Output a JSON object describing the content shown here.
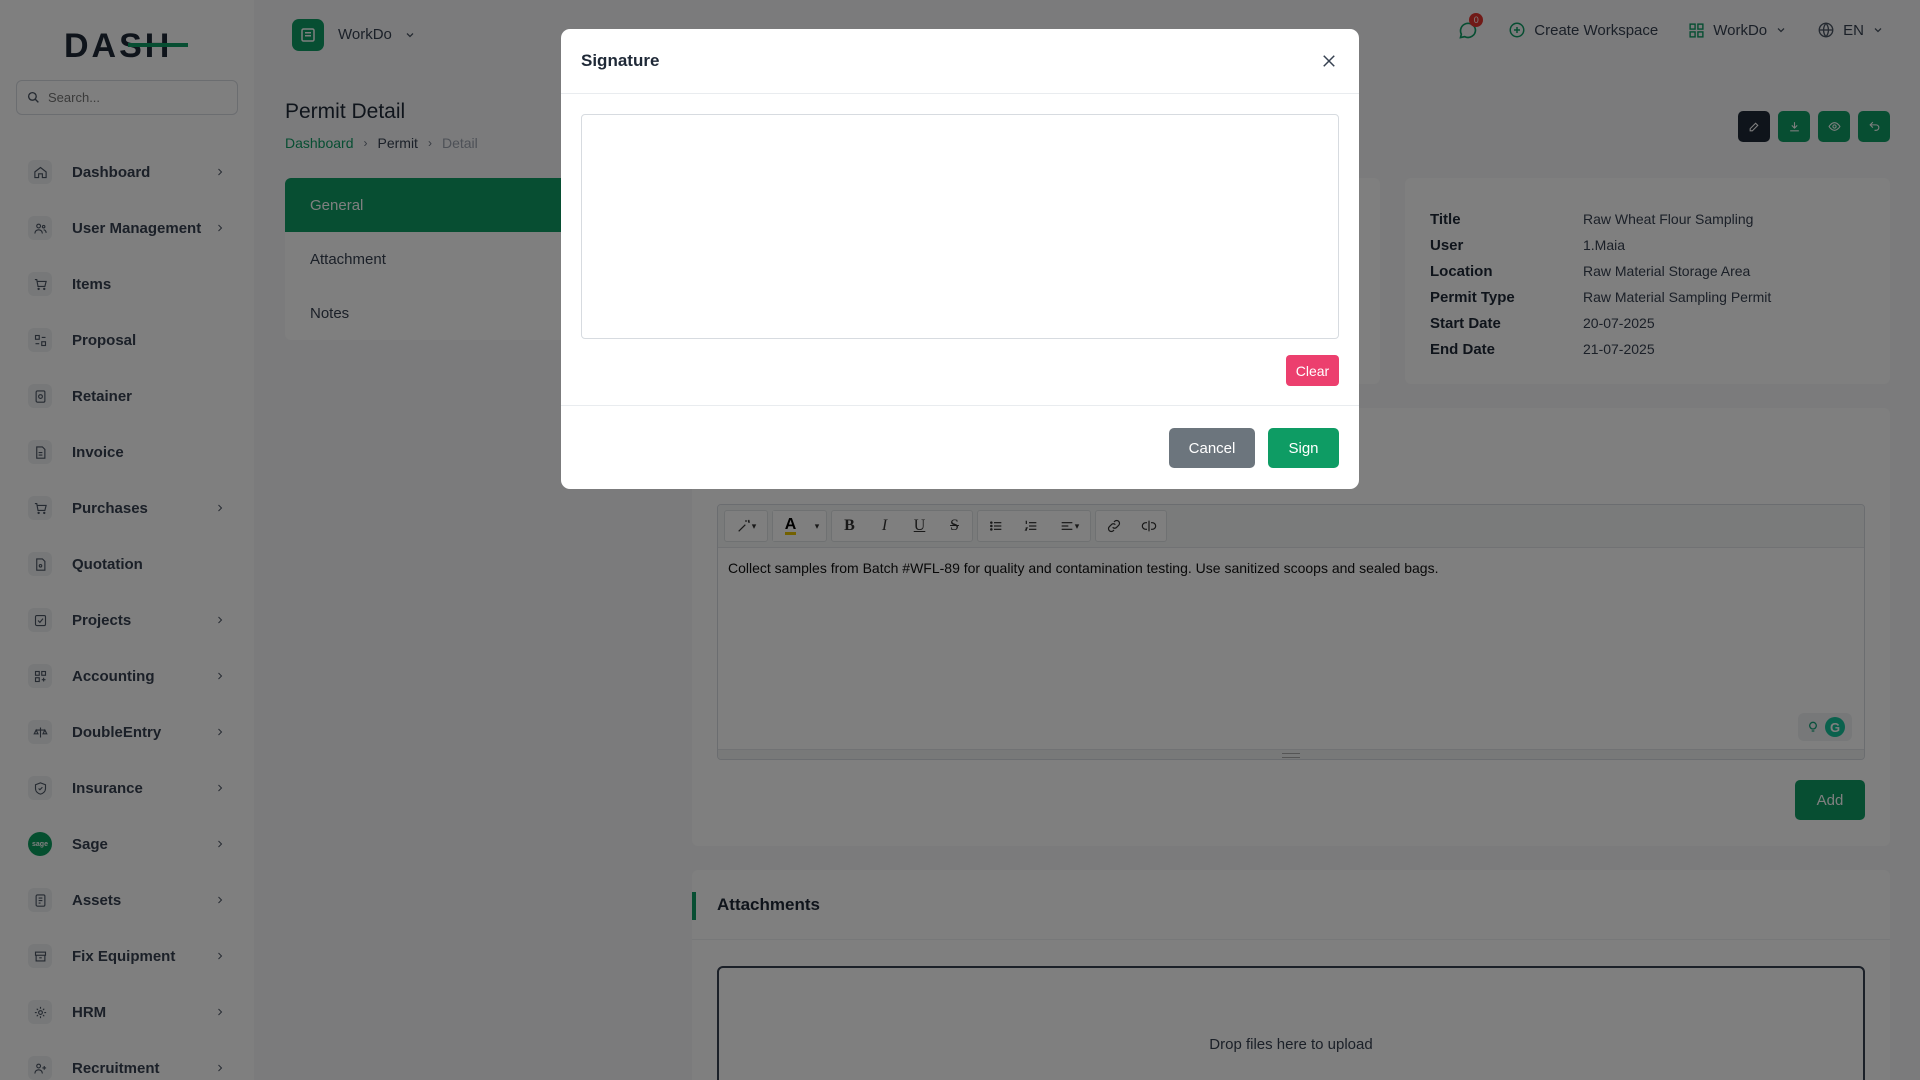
{
  "app": {
    "brand": "DASH"
  },
  "search": {
    "placeholder": "Search..."
  },
  "sidebar": {
    "items": [
      {
        "label": "Dashboard",
        "icon": "home-icon",
        "chevron": true
      },
      {
        "label": "User Management",
        "icon": "users-icon",
        "chevron": true
      },
      {
        "label": "Items",
        "icon": "cart-icon",
        "chevron": false
      },
      {
        "label": "Proposal",
        "icon": "proposal-icon",
        "chevron": false
      },
      {
        "label": "Retainer",
        "icon": "retainer-icon",
        "chevron": false
      },
      {
        "label": "Invoice",
        "icon": "invoice-icon",
        "chevron": false
      },
      {
        "label": "Purchases",
        "icon": "cart-icon",
        "chevron": true
      },
      {
        "label": "Quotation",
        "icon": "quotation-icon",
        "chevron": false
      },
      {
        "label": "Projects",
        "icon": "projects-icon",
        "chevron": true
      },
      {
        "label": "Accounting",
        "icon": "accounting-icon",
        "chevron": true
      },
      {
        "label": "DoubleEntry",
        "icon": "scale-icon",
        "chevron": true
      },
      {
        "label": "Insurance",
        "icon": "shield-icon",
        "chevron": true
      },
      {
        "label": "Sage",
        "icon": "sage-icon",
        "chevron": true
      },
      {
        "label": "Assets",
        "icon": "assets-icon",
        "chevron": true
      },
      {
        "label": "Fix Equipment",
        "icon": "equipment-icon",
        "chevron": true
      },
      {
        "label": "HRM",
        "icon": "hrm-icon",
        "chevron": true
      },
      {
        "label": "Recruitment",
        "icon": "recruitment-icon",
        "chevron": true
      }
    ]
  },
  "header": {
    "workspace": "WorkDo",
    "notification_count": "0",
    "create_workspace": "Create Workspace",
    "workspace_switch": "WorkDo",
    "language": "EN"
  },
  "page": {
    "title": "Permit Detail",
    "breadcrumb": [
      "Dashboard",
      "Permit",
      "Detail"
    ]
  },
  "tabs": [
    "General",
    "Attachment",
    "Notes"
  ],
  "permit": {
    "rows": [
      {
        "key": "Title",
        "value": "Raw Wheat Flour Sampling"
      },
      {
        "key": "User",
        "value": "1.Maia"
      },
      {
        "key": "Location",
        "value": "Raw Material Storage Area"
      },
      {
        "key": "Permit Type",
        "value": "Raw Material Sampling Permit"
      },
      {
        "key": "Start Date",
        "value": "20-07-2025"
      },
      {
        "key": "End Date",
        "value": "21-07-2025"
      }
    ]
  },
  "notes": {
    "content": "Collect samples from Batch #WFL-89 for quality and contamination testing. Use sanitized scoops and sealed bags.",
    "add_label": "Add"
  },
  "attachments": {
    "title": "Attachments",
    "dropzone": "Drop files here to upload"
  },
  "modal": {
    "title": "Signature",
    "clear_label": "Clear",
    "cancel_label": "Cancel",
    "sign_label": "Sign"
  },
  "colors": {
    "brand": "#0e9c64",
    "danger": "#ec3f6e",
    "secondary": "#6c757d"
  }
}
